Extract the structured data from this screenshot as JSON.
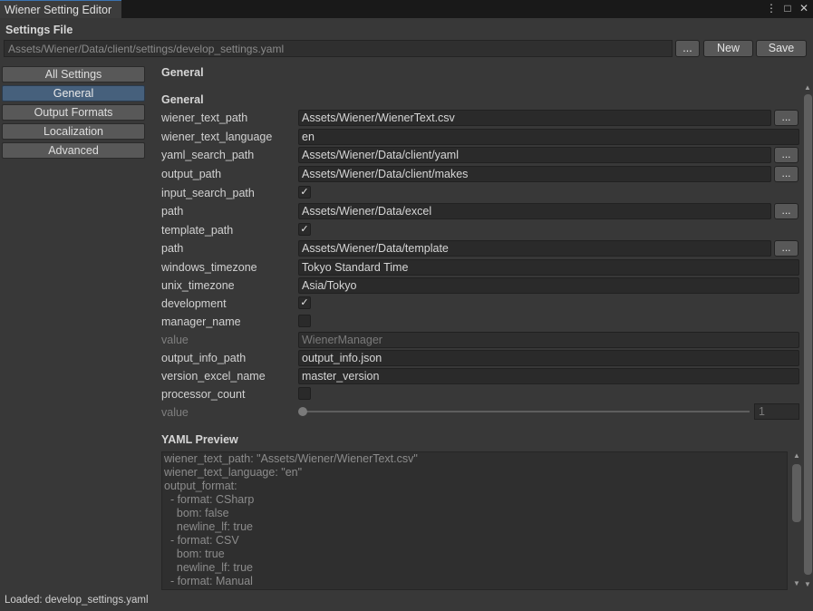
{
  "window": {
    "tab_title": "Wiener Setting Editor",
    "controls": {
      "menu": "⋮",
      "maximize": "□",
      "close": "✕"
    }
  },
  "settings_file": {
    "label": "Settings File",
    "path": "Assets/Wiener/Data/client/settings/develop_settings.yaml",
    "browse_label": "...",
    "new_label": "New",
    "save_label": "Save"
  },
  "sidebar": {
    "items": [
      {
        "label": "All Settings",
        "active": false
      },
      {
        "label": "General",
        "active": true
      },
      {
        "label": "Output Formats",
        "active": false
      },
      {
        "label": "Localization",
        "active": false
      },
      {
        "label": "Advanced",
        "active": false
      }
    ]
  },
  "main": {
    "page_title": "General",
    "section_title": "General",
    "browse_label": "...",
    "fields": [
      {
        "label": "wiener_text_path",
        "value": "Assets/Wiener/WienerText.csv",
        "browse": true
      },
      {
        "label": "wiener_text_language",
        "value": "en"
      },
      {
        "label": "yaml_search_path",
        "value": "Assets/Wiener/Data/client/yaml",
        "browse": true
      },
      {
        "label": "output_path",
        "value": "Assets/Wiener/Data/client/makes",
        "browse": true
      },
      {
        "label": "input_search_path",
        "checked": "✓"
      },
      {
        "label": "path",
        "value": "Assets/Wiener/Data/excel",
        "browse": true
      },
      {
        "label": "template_path",
        "checked": "✓"
      },
      {
        "label": "path",
        "value": "Assets/Wiener/Data/template",
        "browse": true
      },
      {
        "label": "windows_timezone",
        "value": "Tokyo Standard Time"
      },
      {
        "label": "unix_timezone",
        "value": "Asia/Tokyo"
      },
      {
        "label": "development",
        "checked": "✓"
      },
      {
        "label": "manager_name",
        "checked": ""
      },
      {
        "label": "value",
        "value": "WienerManager",
        "disabled": true
      },
      {
        "label": "output_info_path",
        "value": "output_info.json"
      },
      {
        "label": "version_excel_name",
        "value": "master_version"
      },
      {
        "label": "processor_count",
        "checked": ""
      },
      {
        "label": "value",
        "slider_value": "1",
        "disabled": true
      }
    ]
  },
  "yaml_preview": {
    "title": "YAML Preview",
    "lines": [
      "wiener_text_path: \"Assets/Wiener/WienerText.csv\"",
      "wiener_text_language: \"en\"",
      "output_format:",
      "  - format: CSharp",
      "    bom: false",
      "    newline_lf: true",
      "  - format: CSV",
      "    bom: true",
      "    newline_lf: true",
      "  - format: Manual"
    ]
  },
  "status": {
    "text": "Loaded: develop_settings.yaml"
  }
}
